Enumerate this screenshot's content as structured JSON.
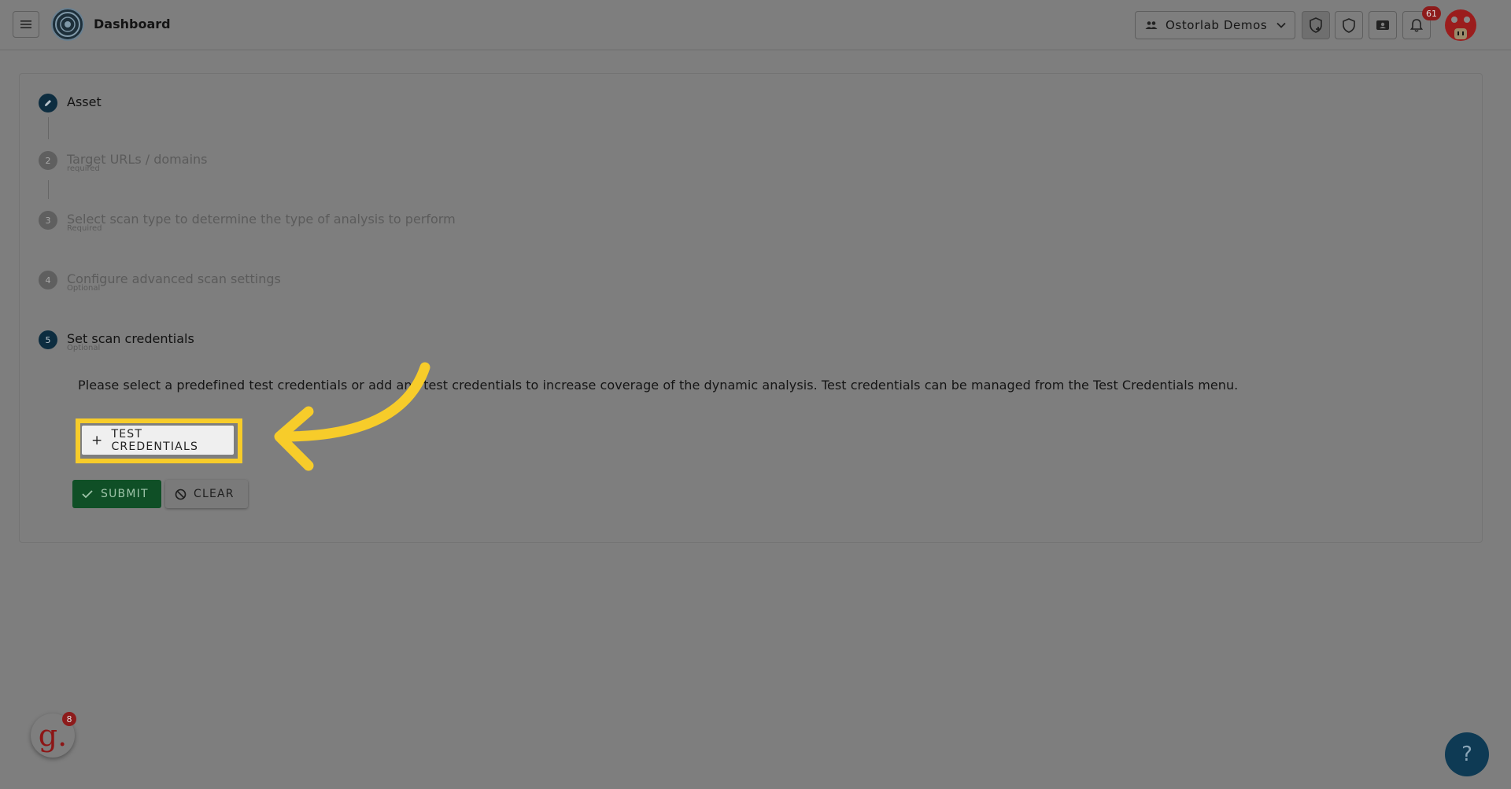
{
  "header": {
    "title": "Dashboard",
    "org_label": "Ostorlab Demos",
    "notification_count": "61"
  },
  "steps": [
    {
      "number": "",
      "title": "Asset",
      "subtitle": "",
      "status": "done"
    },
    {
      "number": "2",
      "title": "Target URLs / domains",
      "subtitle": "required",
      "status": "pending"
    },
    {
      "number": "3",
      "title": "Select scan type to determine the type of analysis to perform",
      "subtitle": "Required",
      "status": "pending"
    },
    {
      "number": "4",
      "title": "Configure advanced scan settings",
      "subtitle": "Optional",
      "status": "pending"
    },
    {
      "number": "5",
      "title": "Set scan credentials",
      "subtitle": "Optional",
      "status": "current"
    }
  ],
  "credentials": {
    "description": "Please select a predefined test credentials or add any test credentials to increase coverage of the dynamic analysis. Test credentials can be managed from the Test Credentials menu.",
    "add_button": "TEST CREDENTIALS"
  },
  "actions": {
    "submit": "SUBMIT",
    "clear": "CLEAR"
  },
  "widget": {
    "letter": "g.",
    "badge": "8"
  },
  "help": {
    "label": "?"
  },
  "colors": {
    "highlight": "#f7cc2a",
    "submit": "#0f4f26",
    "step_active": "#0d2d40",
    "badge": "#8d1b1b"
  }
}
